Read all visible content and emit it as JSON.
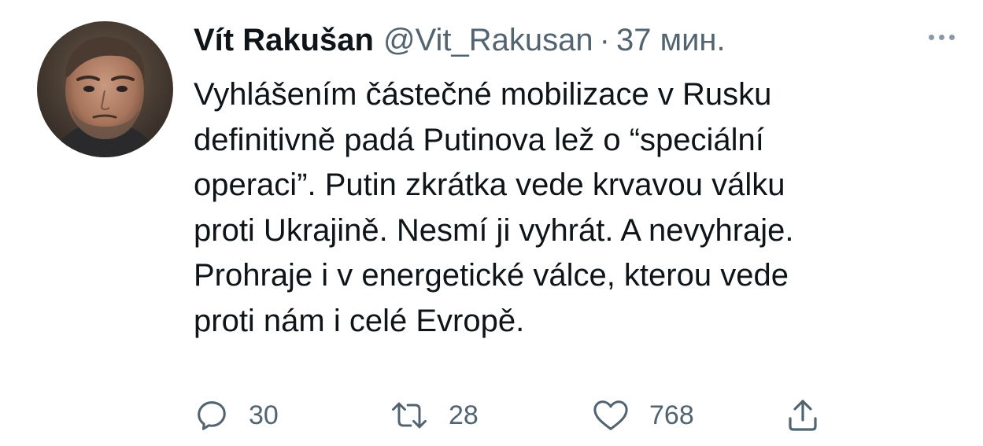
{
  "tweet": {
    "author": {
      "display_name": "Vít Rakušan",
      "handle": "@Vit_Rakusan",
      "separator": "·",
      "time": "37 мин."
    },
    "text_lines": [
      "Vyhlášením částečné mobilizace v Rusku",
      "definitivně padá Putinova lež o “speciální",
      "operaci”. Putin zkrátka vede krvavou válku",
      "proti Ukrajině. Nesmí ji vyhrát. A nevyhraje.",
      "Prohraje i v energetické válce, kterou vede",
      "proti nám i celé Evropě."
    ],
    "actions": {
      "reply": {
        "icon": "reply-icon",
        "count": "30"
      },
      "retweet": {
        "icon": "retweet-icon",
        "count": "28"
      },
      "like": {
        "icon": "heart-icon",
        "count": "768"
      },
      "share": {
        "icon": "share-icon"
      }
    }
  },
  "colors": {
    "text_primary": "#0f1419",
    "text_secondary": "#536471",
    "more_dots": "#8b98a5",
    "background": "#ffffff"
  }
}
